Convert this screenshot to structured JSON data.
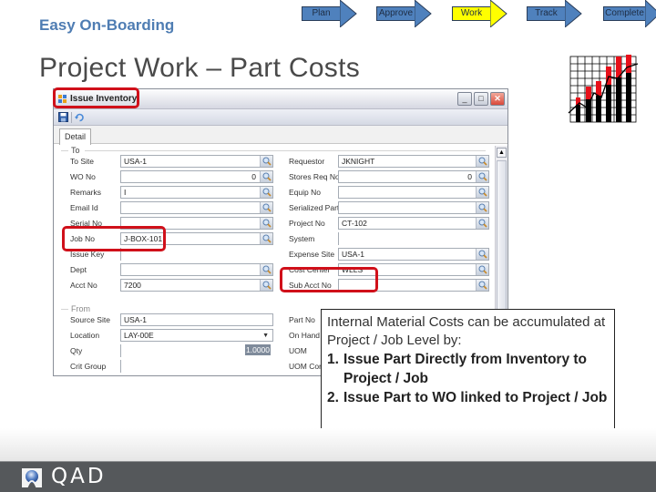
{
  "header": {
    "subtitle": "Easy On-Boarding",
    "title": "Project Work – Part Costs"
  },
  "process_steps": [
    {
      "label": "Plan",
      "active": false
    },
    {
      "label": "Approve",
      "active": false
    },
    {
      "label": "Work",
      "active": true
    },
    {
      "label": "Track",
      "active": false
    },
    {
      "label": "Complete",
      "active": false
    }
  ],
  "colors": {
    "step_inactive": "#4f81bd",
    "step_active": "#ffff00",
    "subtitle": "#4f7db3",
    "highlight": "#d0101a",
    "footer": "#55585b"
  },
  "decor": {
    "chart_icon": "bar-line-chart-icon"
  },
  "window": {
    "title": "Issue Inventory",
    "tab": "Detail",
    "to_group": "To",
    "from_group": "From",
    "left_fields": [
      {
        "label": "To Site",
        "value": "USA-1"
      },
      {
        "label": "WO No",
        "value": "0",
        "numeric": true
      },
      {
        "label": "Remarks",
        "value": "I"
      },
      {
        "label": "Email Id",
        "value": ""
      },
      {
        "label": "Serial No",
        "value": ""
      },
      {
        "label": "Job No",
        "value": "J-BOX-101"
      },
      {
        "label": "Issue Key",
        "value": ""
      },
      {
        "label": "Dept",
        "value": ""
      },
      {
        "label": "Acct No",
        "value": "7200"
      }
    ],
    "right_fields": [
      {
        "label": "Requestor",
        "value": "JKNIGHT"
      },
      {
        "label": "Stores Req No",
        "value": "0",
        "numeric": true
      },
      {
        "label": "Equip No",
        "value": ""
      },
      {
        "label": "Serialized Part",
        "value": ""
      },
      {
        "label": "Project No",
        "value": "CT-102"
      },
      {
        "label": "System",
        "value": ""
      },
      {
        "label": "Expense Site",
        "value": "USA-1"
      },
      {
        "label": "Cost Center",
        "value": "WLLS"
      },
      {
        "label": "Sub Acct No",
        "value": ""
      }
    ],
    "from_fields": [
      {
        "label": "Source Site",
        "value": "USA-1"
      },
      {
        "label": "Location",
        "value": "LAY-00E"
      },
      {
        "label": "Qty",
        "value": "1.0000"
      },
      {
        "label": "Crit Group",
        "value": ""
      }
    ],
    "from_right_labels": [
      "Part No",
      "On Hand",
      "UOM",
      "UOM Conv"
    ]
  },
  "callout": {
    "intro": "Internal Material Costs can be accumulated at Project / Job Level by:",
    "items": [
      {
        "num": "1.",
        "text": "Issue Part Directly from Inventory to Project / Job"
      },
      {
        "num": "2.",
        "text": "Issue Part to WO linked to Project / Job"
      }
    ]
  },
  "footer": {
    "logo_text": "QAD"
  }
}
